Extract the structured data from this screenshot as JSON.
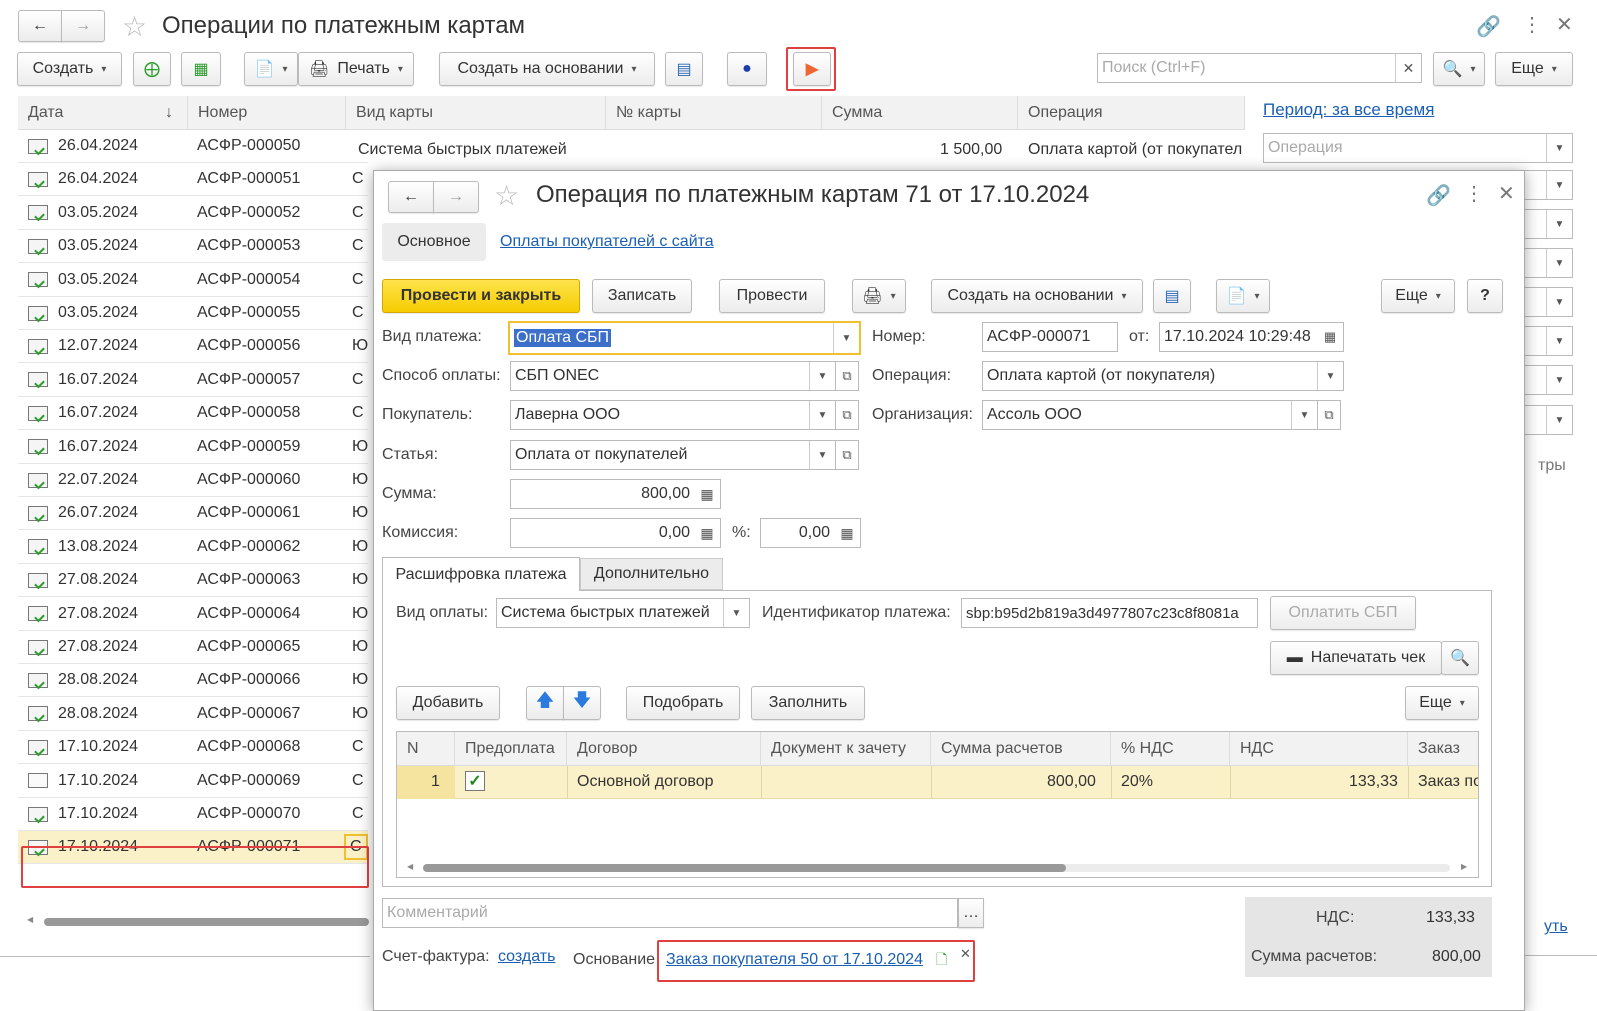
{
  "main": {
    "title": "Операции по платежным картам",
    "toolbar": {
      "create": "Создать",
      "print": "Печать",
      "create_based": "Создать на основании",
      "search_placeholder": "Поиск (Ctrl+F)",
      "more": "Еще"
    },
    "columns": [
      "Дата",
      "Номер",
      "Вид карты",
      "№ карты",
      "Сумма",
      "Операция"
    ],
    "first_row": {
      "vid": "Система быстрых платежей",
      "summa": "1 500,00",
      "operation": "Оплата картой (от покупател"
    },
    "rows": [
      {
        "date": "26.04.2024",
        "num": "АСФР-000050",
        "v": ""
      },
      {
        "date": "26.04.2024",
        "num": "АСФР-000051",
        "v": "С"
      },
      {
        "date": "03.05.2024",
        "num": "АСФР-000052",
        "v": "С"
      },
      {
        "date": "03.05.2024",
        "num": "АСФР-000053",
        "v": "С"
      },
      {
        "date": "03.05.2024",
        "num": "АСФР-000054",
        "v": "С"
      },
      {
        "date": "03.05.2024",
        "num": "АСФР-000055",
        "v": "С"
      },
      {
        "date": "12.07.2024",
        "num": "АСФР-000056",
        "v": "Ю"
      },
      {
        "date": "16.07.2024",
        "num": "АСФР-000057",
        "v": "С"
      },
      {
        "date": "16.07.2024",
        "num": "АСФР-000058",
        "v": "С"
      },
      {
        "date": "16.07.2024",
        "num": "АСФР-000059",
        "v": "Ю"
      },
      {
        "date": "22.07.2024",
        "num": "АСФР-000060",
        "v": "Ю"
      },
      {
        "date": "26.07.2024",
        "num": "АСФР-000061",
        "v": "Ю"
      },
      {
        "date": "13.08.2024",
        "num": "АСФР-000062",
        "v": "Ю"
      },
      {
        "date": "27.08.2024",
        "num": "АСФР-000063",
        "v": "Ю"
      },
      {
        "date": "27.08.2024",
        "num": "АСФР-000064",
        "v": "Ю"
      },
      {
        "date": "27.08.2024",
        "num": "АСФР-000065",
        "v": "Ю"
      },
      {
        "date": "28.08.2024",
        "num": "АСФР-000066",
        "v": "Ю"
      },
      {
        "date": "28.08.2024",
        "num": "АСФР-000067",
        "v": "Ю"
      },
      {
        "date": "17.10.2024",
        "num": "АСФР-000068",
        "v": "С"
      },
      {
        "date": "17.10.2024",
        "num": "АСФР-000069",
        "v": "С"
      },
      {
        "date": "17.10.2024",
        "num": "АСФР-000070",
        "v": "С"
      },
      {
        "date": "17.10.2024",
        "num": "АСФР-000071",
        "v": "С"
      }
    ],
    "period_link": "Период: за все время",
    "operation_placeholder": "Операция",
    "right_cut_1": "тры",
    "right_cut_2": "уть"
  },
  "dialog": {
    "title": "Операция по платежным картам 71 от 17.10.2024",
    "tab_main": "Основное",
    "tab_link": "Оплаты покупателей с сайта",
    "btn_post_close": "Провести и закрыть",
    "btn_write": "Записать",
    "btn_post": "Провести",
    "btn_create_based": "Создать на основании",
    "btn_more": "Еще",
    "btn_help": "?",
    "labels": {
      "vid_platezha": "Вид платежа:",
      "sposob": "Способ оплаты:",
      "pokupatel": "Покупатель:",
      "statya": "Статья:",
      "summa": "Сумма:",
      "komissiya": "Комиссия:",
      "percent": "%:",
      "nomer": "Номер:",
      "ot": "от:",
      "operaciya": "Операция:",
      "organizaciya": "Организация:"
    },
    "values": {
      "vid_platezha": "Оплата СБП",
      "sposob": "СБП ONEC",
      "pokupatel": "Лаверна ООО",
      "statya": "Оплата от покупателей",
      "summa": "800,00",
      "komissiya": "0,00",
      "percent": "0,00",
      "nomer": "АСФР-000071",
      "ot": "17.10.2024 10:29:48",
      "operaciya": "Оплата картой (от покупателя)",
      "organizaciya": "Ассоль ООО"
    },
    "subtab1": "Расшифровка платежа",
    "subtab2": "Дополнительно",
    "vid_oplaty_label": "Вид оплаты:",
    "vid_oplaty": "Система быстрых платежей",
    "id_label": "Идентификатор платежа:",
    "id_value": "sbp:b95d2b819a3d4977807c23c8f8081a",
    "btn_pay_sbp": "Оплатить СБП",
    "btn_print_check": "Напечатать чек",
    "btn_add": "Добавить",
    "btn_pick": "Подобрать",
    "btn_fill": "Заполнить",
    "btn_more2": "Еще",
    "table_cols": [
      "N",
      "Предоплата",
      "Договор",
      "Документ к зачету",
      "Сумма расчетов",
      "% НДС",
      "НДС",
      "Заказ"
    ],
    "table_row": {
      "n": "1",
      "dogovor": "Основной договор",
      "doc": "",
      "summa": "800,00",
      "nds_pct": "20%",
      "nds": "133,33",
      "zakaz": "Заказ по"
    },
    "comment_placeholder": "Комментарий",
    "nds_label": "НДС:",
    "nds_value": "133,33",
    "sum_label": "Сумма расчетов:",
    "sum_value": "800,00",
    "invoice_label": "Счет-фактура:",
    "invoice_link": "создать",
    "basis_label": "Основание",
    "basis_link": "Заказ покупателя 50 от 17.10.2024"
  }
}
